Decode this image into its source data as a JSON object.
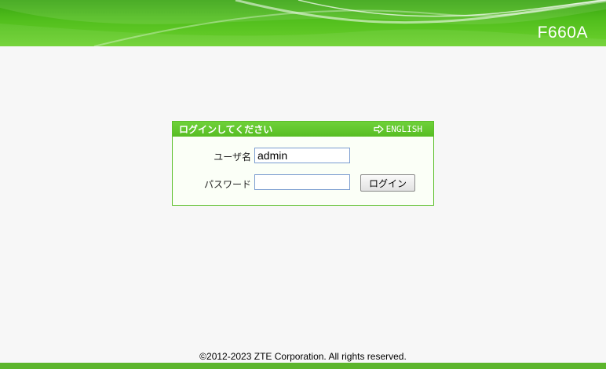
{
  "header": {
    "model": "F660A",
    "brand_color": "#4cb91c"
  },
  "login": {
    "title": "ログインしてください",
    "language_link": "ENGLISH",
    "language_icon": "arrow-right-icon",
    "username_label": "ユーザ名",
    "username_value": "admin",
    "password_label": "パスワード",
    "password_value": "",
    "submit_label": "ログイン"
  },
  "footer": {
    "copyright": "©2012-2023 ZTE Corporation. All rights reserved."
  }
}
